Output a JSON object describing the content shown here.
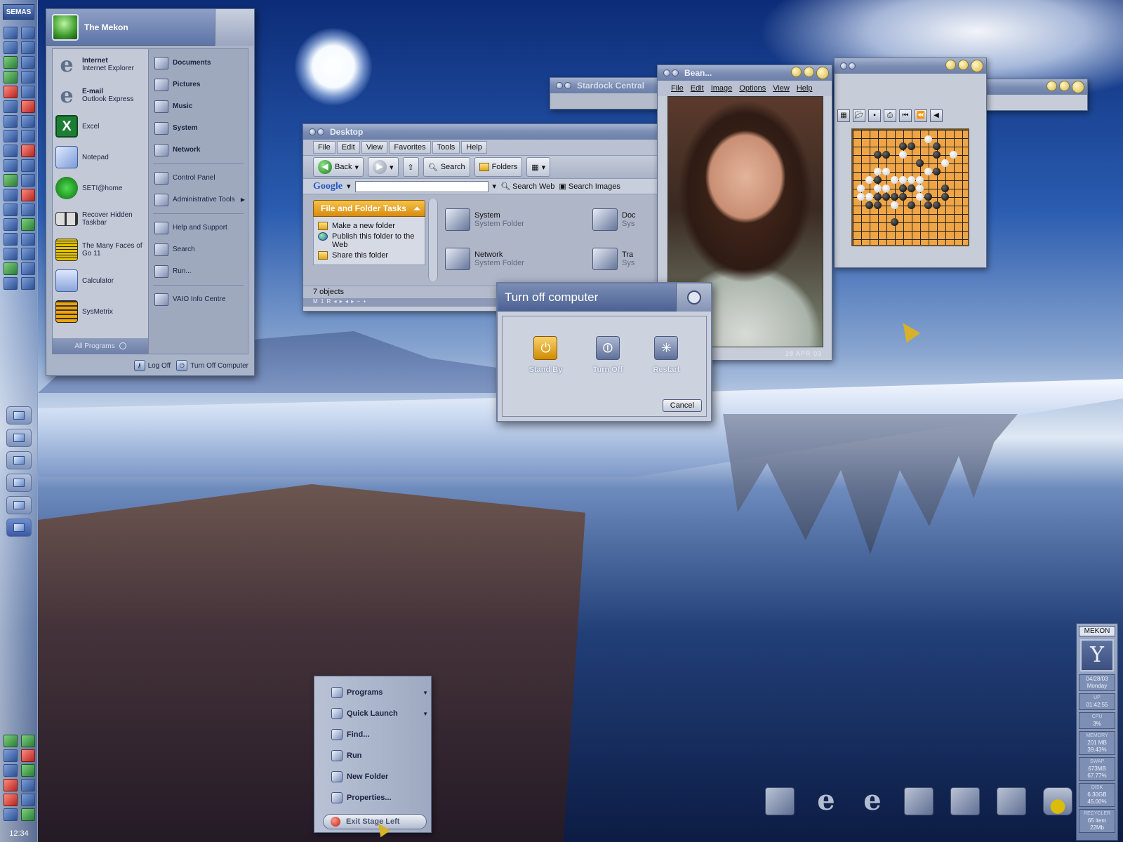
{
  "dock": {
    "logo": "SEMAS",
    "clock": "12:34"
  },
  "start_menu": {
    "user": "The Mekon",
    "left_items": [
      {
        "title": "Internet",
        "sub": "Internet Explorer",
        "icon": "internet-explorer-icon"
      },
      {
        "title": "E-mail",
        "sub": "Outlook Express",
        "icon": "outlook-express-icon"
      },
      {
        "title": "Excel",
        "sub": "",
        "icon": "excel-icon"
      },
      {
        "title": "Notepad",
        "sub": "",
        "icon": "notepad-icon"
      },
      {
        "title": "SETI@home",
        "sub": "",
        "icon": "seti-icon"
      },
      {
        "title": "Recover Hidden Taskbar",
        "sub": "",
        "icon": "taskbar-icon"
      },
      {
        "title": "The Many Faces of Go 11",
        "sub": "",
        "icon": "go-board-icon"
      },
      {
        "title": "Calculator",
        "sub": "",
        "icon": "calculator-icon"
      },
      {
        "title": "SysMetrix",
        "sub": "",
        "icon": "sysmetrix-icon"
      }
    ],
    "all_programs": "All Programs",
    "right_items": [
      {
        "label": "Documents"
      },
      {
        "label": "Pictures"
      },
      {
        "label": "Music"
      },
      {
        "label": "System"
      },
      {
        "label": "Network"
      },
      {
        "label": "Control Panel"
      },
      {
        "label": "Administrative Tools"
      },
      {
        "label": "Help and Support"
      },
      {
        "label": "Search"
      },
      {
        "label": "Run..."
      },
      {
        "label": "VAIO Info Centre"
      }
    ],
    "log_off": "Log Off",
    "turn_off": "Turn Off Computer"
  },
  "explorer": {
    "title": "Desktop",
    "menu": [
      "File",
      "Edit",
      "View",
      "Favorites",
      "Tools",
      "Help"
    ],
    "back": "Back",
    "search": "Search",
    "folders": "Folders",
    "google_logo": "Google",
    "search_web": "Search Web",
    "search_images": "Search Images",
    "task_header": "File and Folder Tasks",
    "tasks": [
      "Make a new folder",
      "Publish this folder to the Web",
      "Share this folder"
    ],
    "files": [
      {
        "name": "System",
        "type": "System Folder"
      },
      {
        "name": "Doc",
        "type": "Sys"
      },
      {
        "name": "Network",
        "type": "System Folder"
      },
      {
        "name": "Tra",
        "type": "Sys"
      }
    ],
    "status": "7 objects",
    "bottom_strip": "M 1 R ◂ ▸ ◂ ▸ − +"
  },
  "stardock": {
    "title": "Stardock Central"
  },
  "bean": {
    "title": "Bean...",
    "menu": [
      "File",
      "Edit",
      "Image",
      "Options",
      "View",
      "Help"
    ],
    "date": "28 APR 03"
  },
  "turn_off_dialog": {
    "title": "Turn off computer",
    "options": [
      {
        "label": "Stand By",
        "glyph": "⏻"
      },
      {
        "label": "Turn Off",
        "glyph": "⏼"
      },
      {
        "label": "Restart",
        "glyph": "✳"
      }
    ],
    "cancel": "Cancel"
  },
  "context_menu": {
    "items": [
      {
        "label": "Programs",
        "arrow": true
      },
      {
        "label": "Quick Launch",
        "arrow": true
      },
      {
        "label": "Find...",
        "arrow": false
      },
      {
        "label": "Run",
        "arrow": false
      },
      {
        "label": "New Folder",
        "arrow": false
      },
      {
        "label": "Properties...",
        "arrow": false
      }
    ],
    "exit": "Exit Stage Left"
  },
  "sysmon": {
    "name": "MEKON",
    "clock_glyph": "Y",
    "date": "04/28/03",
    "day": "Monday",
    "stats": [
      {
        "label": "UP",
        "value": "01:42:55"
      },
      {
        "label": "CPU",
        "value": "3%"
      },
      {
        "label": "MEMORY",
        "value": "201 MB",
        "extra": "39.43%"
      },
      {
        "label": "SWAP",
        "value": "673MB",
        "extra": "67.77%"
      },
      {
        "label": "DISK",
        "value": "6.30GB",
        "extra": "45.00%"
      },
      {
        "label": "RECYCLER",
        "value": "65 item",
        "extra": "22Mb"
      }
    ]
  }
}
